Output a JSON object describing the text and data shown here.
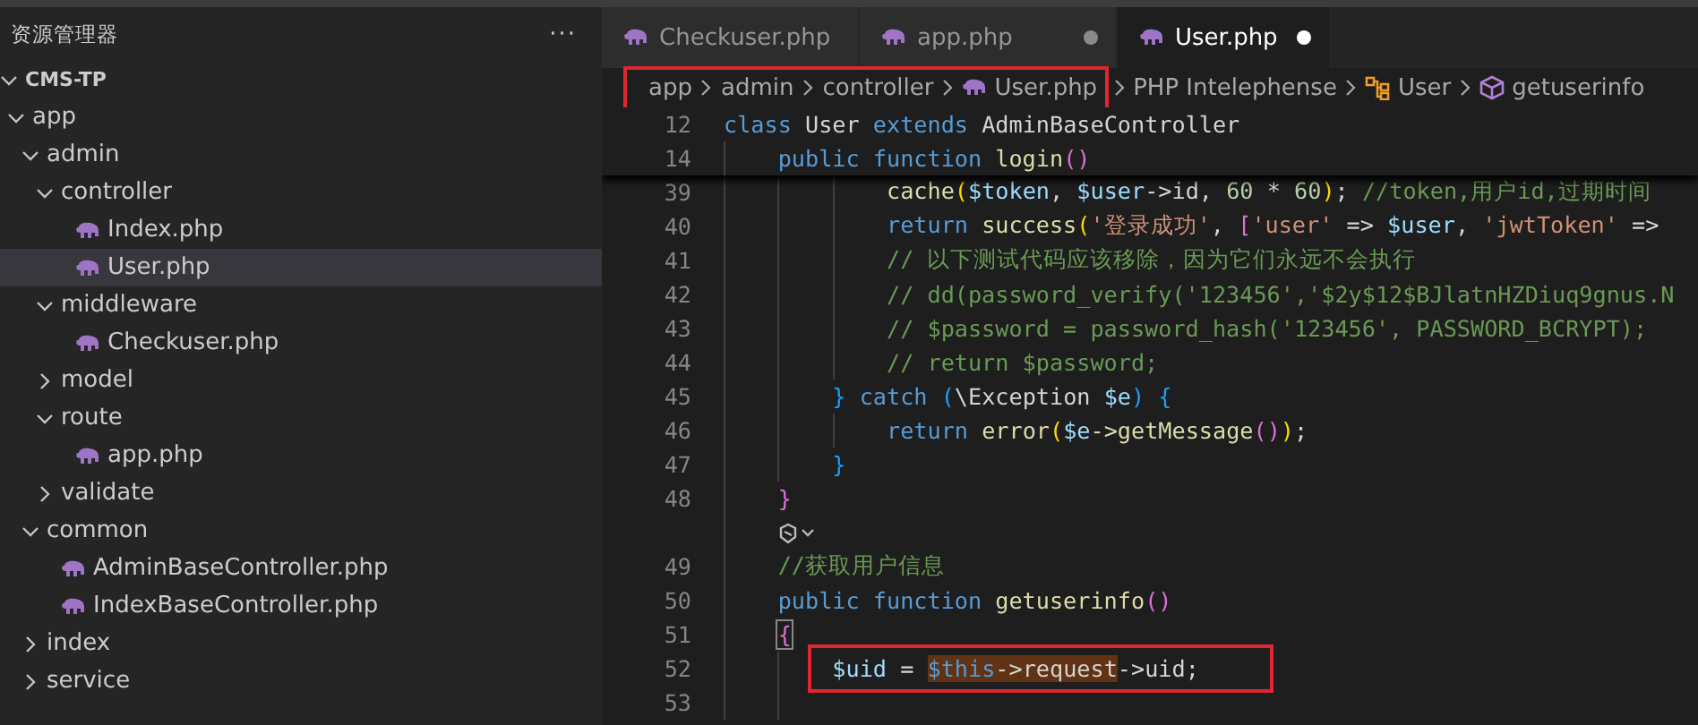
{
  "sidebar": {
    "title": "资源管理器",
    "more": "···",
    "tree": [
      {
        "name": "CMS-TP",
        "kind": "root",
        "expanded": true,
        "selected": false,
        "children": [
          {
            "name": "app",
            "kind": "folder",
            "expanded": true,
            "selected": false,
            "children": [
              {
                "name": "admin",
                "kind": "folder",
                "expanded": true,
                "selected": false,
                "children": [
                  {
                    "name": "controller",
                    "kind": "folder",
                    "expanded": true,
                    "selected": false,
                    "children": [
                      {
                        "name": "Index.php",
                        "kind": "file",
                        "selected": false
                      },
                      {
                        "name": "User.php",
                        "kind": "file",
                        "selected": true
                      }
                    ]
                  },
                  {
                    "name": "middleware",
                    "kind": "folder",
                    "expanded": true,
                    "selected": false,
                    "children": [
                      {
                        "name": "Checkuser.php",
                        "kind": "file",
                        "selected": false
                      }
                    ]
                  },
                  {
                    "name": "model",
                    "kind": "folder",
                    "expanded": false,
                    "selected": false
                  },
                  {
                    "name": "route",
                    "kind": "folder",
                    "expanded": true,
                    "selected": false,
                    "children": [
                      {
                        "name": "app.php",
                        "kind": "file",
                        "selected": false
                      }
                    ]
                  },
                  {
                    "name": "validate",
                    "kind": "folder",
                    "expanded": false,
                    "selected": false
                  }
                ]
              },
              {
                "name": "common",
                "kind": "folder",
                "expanded": true,
                "selected": false,
                "children": [
                  {
                    "name": "AdminBaseController.php",
                    "kind": "file",
                    "selected": false
                  },
                  {
                    "name": "IndexBaseController.php",
                    "kind": "file",
                    "selected": false
                  }
                ]
              },
              {
                "name": "index",
                "kind": "folder",
                "expanded": false,
                "selected": false
              },
              {
                "name": "service",
                "kind": "folder",
                "expanded": false,
                "selected": false
              }
            ]
          }
        ]
      }
    ]
  },
  "tabs": [
    {
      "label": "Checkuser.php",
      "selected": false,
      "dirty": false
    },
    {
      "label": "app.php",
      "selected": false,
      "dirty": true
    },
    {
      "label": "User.php",
      "selected": true,
      "dirty": true
    }
  ],
  "breadcrumb": {
    "boxed": [
      {
        "label": "app",
        "kind": "folder"
      },
      {
        "label": "admin",
        "kind": "folder"
      },
      {
        "label": "controller",
        "kind": "folder"
      },
      {
        "label": "User.php",
        "kind": "file"
      }
    ],
    "rest": [
      {
        "label": "PHP Intelephense",
        "kind": "folder"
      },
      {
        "label": "User",
        "kind": "class"
      },
      {
        "label": "getuserinfo",
        "kind": "method"
      }
    ]
  },
  "sticky_lines": [
    {
      "kind": "code",
      "number": "12",
      "tokens": [
        {
          "text": "class",
          "kind": "kw"
        },
        {
          "text": " User ",
          "kind": "plain"
        },
        {
          "text": "extends",
          "kind": "kw"
        },
        {
          "text": " AdminBaseController",
          "kind": "plain"
        }
      ],
      "children": [
        {
          "kind": "code",
          "number": "14",
          "tokens": [
            {
              "text": "public function",
              "kind": "kw"
            },
            {
              "text": " login",
              "kind": "fn"
            },
            {
              "text": "()",
              "kind": "b2"
            }
          ]
        }
      ]
    }
  ],
  "lines": [
    {
      "kind": "block",
      "children": [
        {
          "kind": "block",
          "children": [
            {
              "kind": "block",
              "children": [
                {
                  "kind": "code",
                  "number": "39",
                  "tokens": [
                    {
                      "text": "cache",
                      "kind": "fn"
                    },
                    {
                      "text": "(",
                      "kind": "b1"
                    },
                    {
                      "text": "$token",
                      "kind": "var"
                    },
                    {
                      "text": ", ",
                      "kind": "plain"
                    },
                    {
                      "text": "$user",
                      "kind": "var"
                    },
                    {
                      "text": "->id, ",
                      "kind": "plain"
                    },
                    {
                      "text": "60",
                      "kind": "num"
                    },
                    {
                      "text": " * ",
                      "kind": "plain"
                    },
                    {
                      "text": "60",
                      "kind": "num"
                    },
                    {
                      "text": ")",
                      "kind": "b1"
                    },
                    {
                      "text": "; ",
                      "kind": "plain"
                    },
                    {
                      "text": "//token,用户id,过期时间",
                      "kind": "comment"
                    }
                  ]
                },
                {
                  "kind": "code",
                  "number": "40",
                  "tokens": [
                    {
                      "text": "return",
                      "kind": "kw"
                    },
                    {
                      "text": " success",
                      "kind": "fn"
                    },
                    {
                      "text": "(",
                      "kind": "b1"
                    },
                    {
                      "text": "'登录成功'",
                      "kind": "str"
                    },
                    {
                      "text": ", ",
                      "kind": "plain"
                    },
                    {
                      "text": "[",
                      "kind": "b2"
                    },
                    {
                      "text": "'user'",
                      "kind": "str"
                    },
                    {
                      "text": " => ",
                      "kind": "plain"
                    },
                    {
                      "text": "$user",
                      "kind": "var"
                    },
                    {
                      "text": ", ",
                      "kind": "plain"
                    },
                    {
                      "text": "'jwtToken'",
                      "kind": "str"
                    },
                    {
                      "text": " =>",
                      "kind": "plain"
                    }
                  ]
                },
                {
                  "kind": "code",
                  "number": "41",
                  "tokens": [
                    {
                      "text": "// 以下测试代码应该移除，因为它们永远不会执行",
                      "kind": "comment"
                    }
                  ]
                },
                {
                  "kind": "code",
                  "number": "42",
                  "tokens": [
                    {
                      "text": "// dd(password_verify('123456','$2y$12$BJlatnHZDiuq9gnus.N",
                      "kind": "comment"
                    }
                  ]
                },
                {
                  "kind": "code",
                  "number": "43",
                  "tokens": [
                    {
                      "text": "// $password = password_hash('123456', PASSWORD_BCRYPT);",
                      "kind": "comment"
                    }
                  ]
                },
                {
                  "kind": "code",
                  "number": "44",
                  "tokens": [
                    {
                      "text": "// return $password;",
                      "kind": "comment"
                    }
                  ]
                }
              ]
            },
            {
              "kind": "code",
              "number": "45",
              "tokens": [
                {
                  "text": "}",
                  "kind": "b3"
                },
                {
                  "text": " catch ",
                  "kind": "kw"
                },
                {
                  "text": "(",
                  "kind": "b3"
                },
                {
                  "text": "\\Exception ",
                  "kind": "plain"
                },
                {
                  "text": "$e",
                  "kind": "var"
                },
                {
                  "text": ")",
                  "kind": "b3"
                },
                {
                  "text": " {",
                  "kind": "b3"
                }
              ]
            },
            {
              "kind": "block",
              "children": [
                {
                  "kind": "code",
                  "number": "46",
                  "tokens": [
                    {
                      "text": "return",
                      "kind": "kw"
                    },
                    {
                      "text": " error",
                      "kind": "fn"
                    },
                    {
                      "text": "(",
                      "kind": "b1"
                    },
                    {
                      "text": "$e",
                      "kind": "var"
                    },
                    {
                      "text": "->getMessage",
                      "kind": "fn"
                    },
                    {
                      "text": "()",
                      "kind": "b2"
                    },
                    {
                      "text": ")",
                      "kind": "b1"
                    },
                    {
                      "text": ";",
                      "kind": "plain"
                    }
                  ]
                }
              ]
            },
            {
              "kind": "code",
              "number": "47",
              "tokens": [
                {
                  "text": "}",
                  "kind": "b3"
                }
              ]
            }
          ]
        },
        {
          "kind": "code",
          "number": "48",
          "tokens": [
            {
              "text": "}",
              "kind": "b2"
            }
          ]
        },
        {
          "kind": "lens"
        },
        {
          "kind": "code",
          "number": "49",
          "tokens": [
            {
              "text": "//获取用户信息",
              "kind": "comment"
            }
          ]
        },
        {
          "kind": "code",
          "number": "50",
          "tokens": [
            {
              "text": "public function",
              "kind": "kw"
            },
            {
              "text": " getuserinfo",
              "kind": "fn"
            },
            {
              "text": "()",
              "kind": "b2"
            }
          ]
        },
        {
          "kind": "code",
          "number": "51",
          "tokens": [
            {
              "text": "{",
              "kind": "b2match"
            }
          ]
        },
        {
          "kind": "block",
          "children": [
            {
              "kind": "code",
              "number": "52",
              "boxed": true,
              "tokens": [
                {
                  "text": "$uid",
                  "kind": "var"
                },
                {
                  "text": " = ",
                  "kind": "plain"
                },
                {
                  "text": "$this",
                  "kind": "matchkw"
                },
                {
                  "text": "->request",
                  "kind": "matchplain"
                },
                {
                  "text": "->uid;",
                  "kind": "plain"
                }
              ]
            },
            {
              "kind": "code",
              "number": "53"
            }
          ]
        }
      ]
    }
  ]
}
